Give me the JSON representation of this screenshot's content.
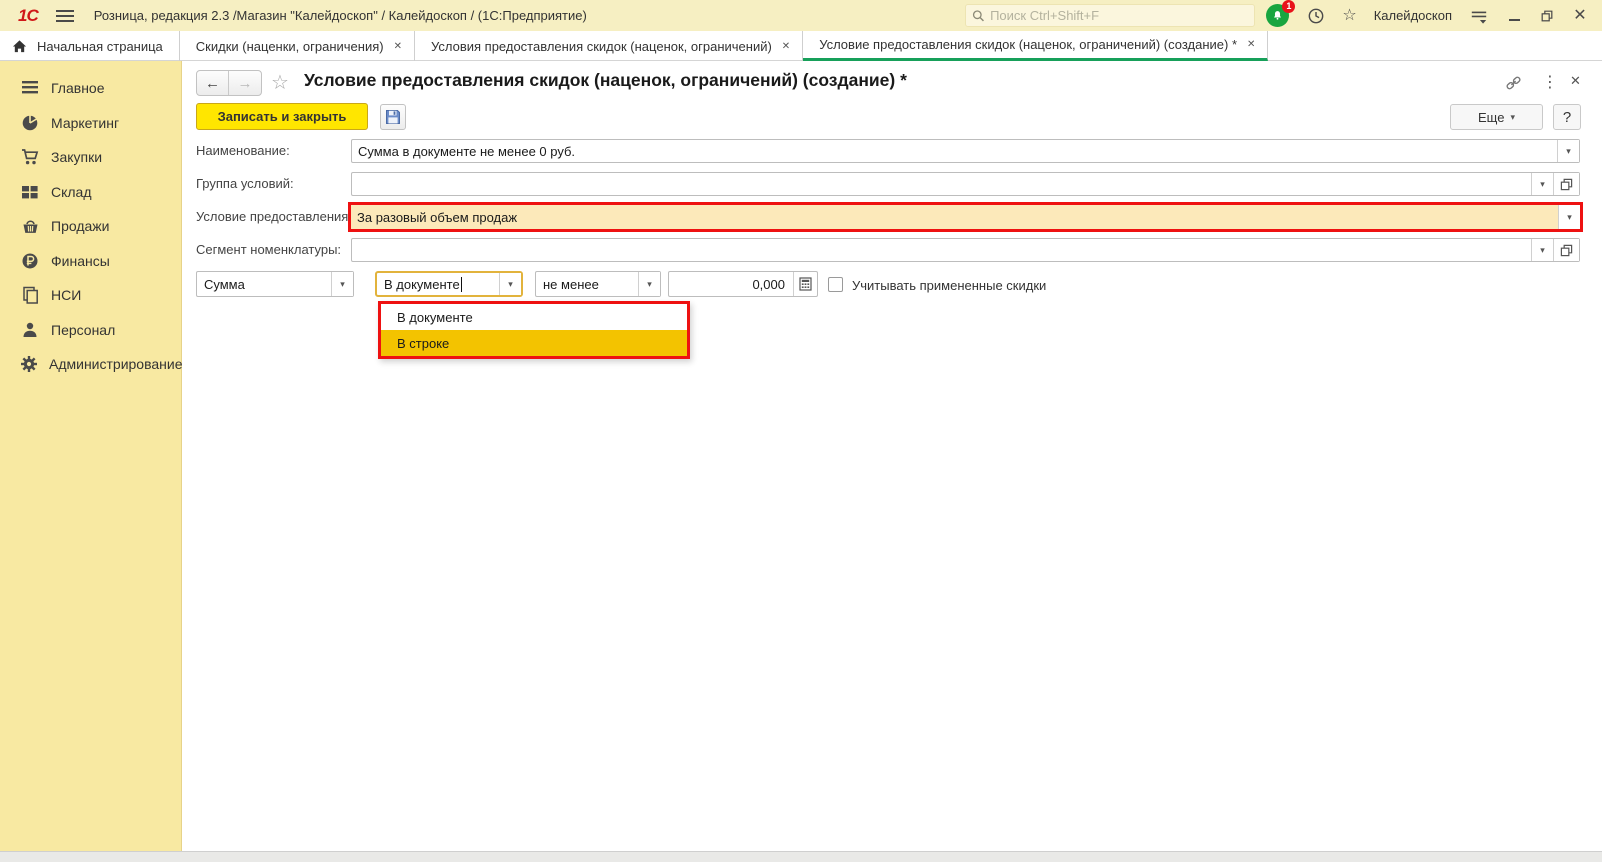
{
  "titlebar": {
    "app_title": "Розница, редакция 2.3 /Магазин \"Калейдоскоп\" / Калейдоскоп /  (1С:Предприятие)",
    "logo": "1С",
    "search_placeholder": "Поиск Ctrl+Shift+F",
    "notification_count": "1",
    "user_name": "Калейдоскоп"
  },
  "icons": {
    "dropdown_arrow": "▾",
    "kebab": "⋮",
    "star_outline": "☆",
    "close": "✕",
    "back_arrow": "←",
    "forward_arrow": "→"
  },
  "tabs": [
    {
      "label": "Начальная страница",
      "closable": false,
      "active": false
    },
    {
      "label": "Скидки (наценки, ограничения)",
      "closable": true,
      "active": false
    },
    {
      "label": "Условия предоставления скидок (наценок, ограничений)",
      "closable": true,
      "active": false
    },
    {
      "label": "Условие предоставления скидок (наценок, ограничений) (создание) *",
      "closable": true,
      "active": true
    }
  ],
  "sidebar": {
    "items": [
      {
        "label": "Главное",
        "icon": "menu-lines-icon"
      },
      {
        "label": "Маркетинг",
        "icon": "pie-chart-icon"
      },
      {
        "label": "Закупки",
        "icon": "cart-icon"
      },
      {
        "label": "Склад",
        "icon": "warehouse-grid-icon"
      },
      {
        "label": "Продажи",
        "icon": "basket-icon"
      },
      {
        "label": "Финансы",
        "icon": "ruble-coin-icon"
      },
      {
        "label": "НСИ",
        "icon": "pages-icon"
      },
      {
        "label": "Персонал",
        "icon": "person-icon"
      },
      {
        "label": "Администрирование",
        "icon": "gear-icon"
      }
    ]
  },
  "content": {
    "title": "Условие предоставления скидок (наценок, ограничений) (создание) *",
    "toolbar": {
      "save_and_close": "Записать и закрыть",
      "more": "Еще",
      "help": "?"
    },
    "fields": {
      "name": {
        "label": "Наименование:",
        "value": "Сумма в документе не менее 0 руб."
      },
      "group": {
        "label": "Группа условий:",
        "value": ""
      },
      "condition": {
        "label": "Условие предоставления:",
        "value": "За разовый объем продаж"
      },
      "segment": {
        "label": "Сегмент номенклатуры:",
        "value": ""
      }
    },
    "criteria": {
      "metric": "Сумма",
      "scope": "В документе",
      "comparison": "не менее",
      "amount": "0,000",
      "consider_discounts_label": "Учитывать примененные скидки",
      "consider_discounts_checked": false
    },
    "scope_dropdown": {
      "options": [
        {
          "label": "В документе",
          "highlighted": false
        },
        {
          "label": "В строке",
          "highlighted": true
        }
      ]
    }
  },
  "colors": {
    "topbar_bg": "#f6efc2",
    "sidebar_bg": "#f8e9a2",
    "accent_yellow": "#ffe600",
    "highlight_field_bg": "#fce9ba",
    "annotation_red": "#ee1111",
    "selection_gold": "#f3c300",
    "active_tab_green": "#17a05a",
    "notification_green": "#18a540",
    "badge_red": "#e8131b"
  }
}
